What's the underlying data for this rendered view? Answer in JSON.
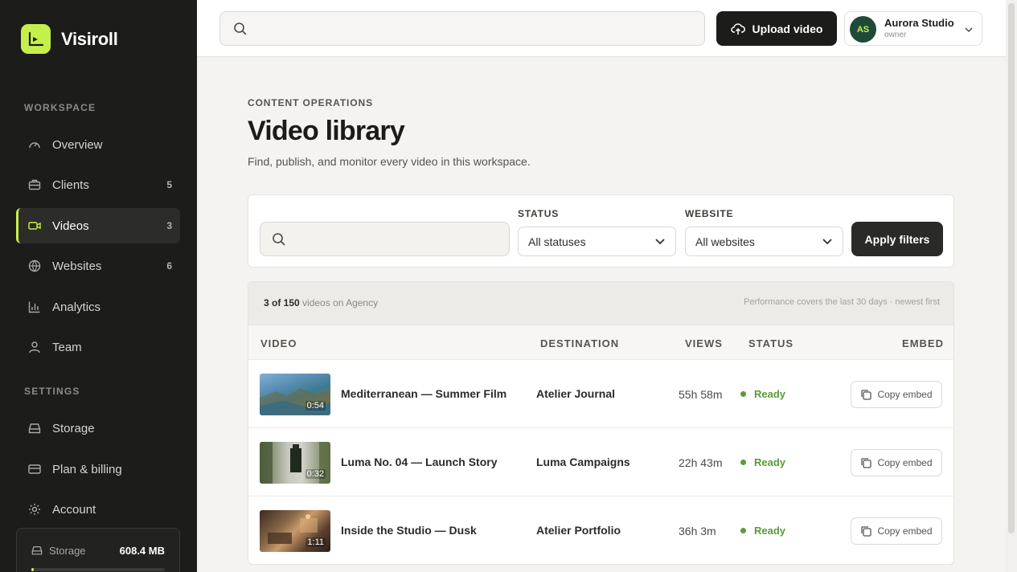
{
  "brand": {
    "name": "Visiroll"
  },
  "sidebar": {
    "workspace_label": "WORKSPACE",
    "settings_label": "SETTINGS",
    "workspace_items": [
      {
        "label": "Overview",
        "count": "",
        "icon": "gauge-icon"
      },
      {
        "label": "Clients",
        "count": "5",
        "icon": "briefcase-icon"
      },
      {
        "label": "Videos",
        "count": "3",
        "icon": "video-camera-icon",
        "active": true
      },
      {
        "label": "Websites",
        "count": "6",
        "icon": "globe-icon"
      },
      {
        "label": "Analytics",
        "count": "",
        "icon": "bar-chart-icon"
      },
      {
        "label": "Team",
        "count": "",
        "icon": "user-icon"
      }
    ],
    "settings_items": [
      {
        "label": "Storage",
        "icon": "drive-icon"
      },
      {
        "label": "Plan & billing",
        "icon": "credit-card-icon"
      },
      {
        "label": "Account",
        "icon": "gear-icon"
      }
    ],
    "storage_card": {
      "label": "Storage",
      "value": "608.4 MB",
      "fill_fraction": 0.02
    }
  },
  "topbar": {
    "search_placeholder": "",
    "upload_label": "Upload video",
    "user": {
      "initials": "AS",
      "name": "Aurora Studio",
      "role": "owner"
    }
  },
  "page": {
    "eyebrow": "CONTENT OPERATIONS",
    "title": "Video library",
    "subtitle": "Find, publish, and monitor every video in this workspace."
  },
  "filters": {
    "search_placeholder": "",
    "status_label": "STATUS",
    "status_value": "All statuses",
    "website_label": "WEBSITE",
    "website_value": "All websites",
    "apply_label": "Apply filters"
  },
  "table": {
    "count_strong": "3 of 150",
    "count_rest": " videos on Agency",
    "note": "Performance covers the last 30 days · newest first",
    "headers": {
      "video": "VIDEO",
      "destination": "DESTINATION",
      "views": "VIEWS",
      "status": "STATUS",
      "embed": "EMBED"
    },
    "rows": [
      {
        "title": "Mediterranean — Summer Film",
        "duration": "0:54",
        "destination": "Atelier Journal",
        "views": "55h 58m",
        "status": "Ready",
        "embed": "Copy embed"
      },
      {
        "title": "Luma No. 04 — Launch Story",
        "duration": "0:32",
        "destination": "Luma Campaigns",
        "views": "22h 43m",
        "status": "Ready",
        "embed": "Copy embed"
      },
      {
        "title": "Inside the Studio — Dusk",
        "duration": "1:11",
        "destination": "Atelier Portfolio",
        "views": "36h 3m",
        "status": "Ready",
        "embed": "Copy embed"
      }
    ]
  },
  "colors": {
    "accent": "#c5f04b",
    "sidebar_bg": "#1c1c1b",
    "status_ready": "#5a9a3a"
  }
}
